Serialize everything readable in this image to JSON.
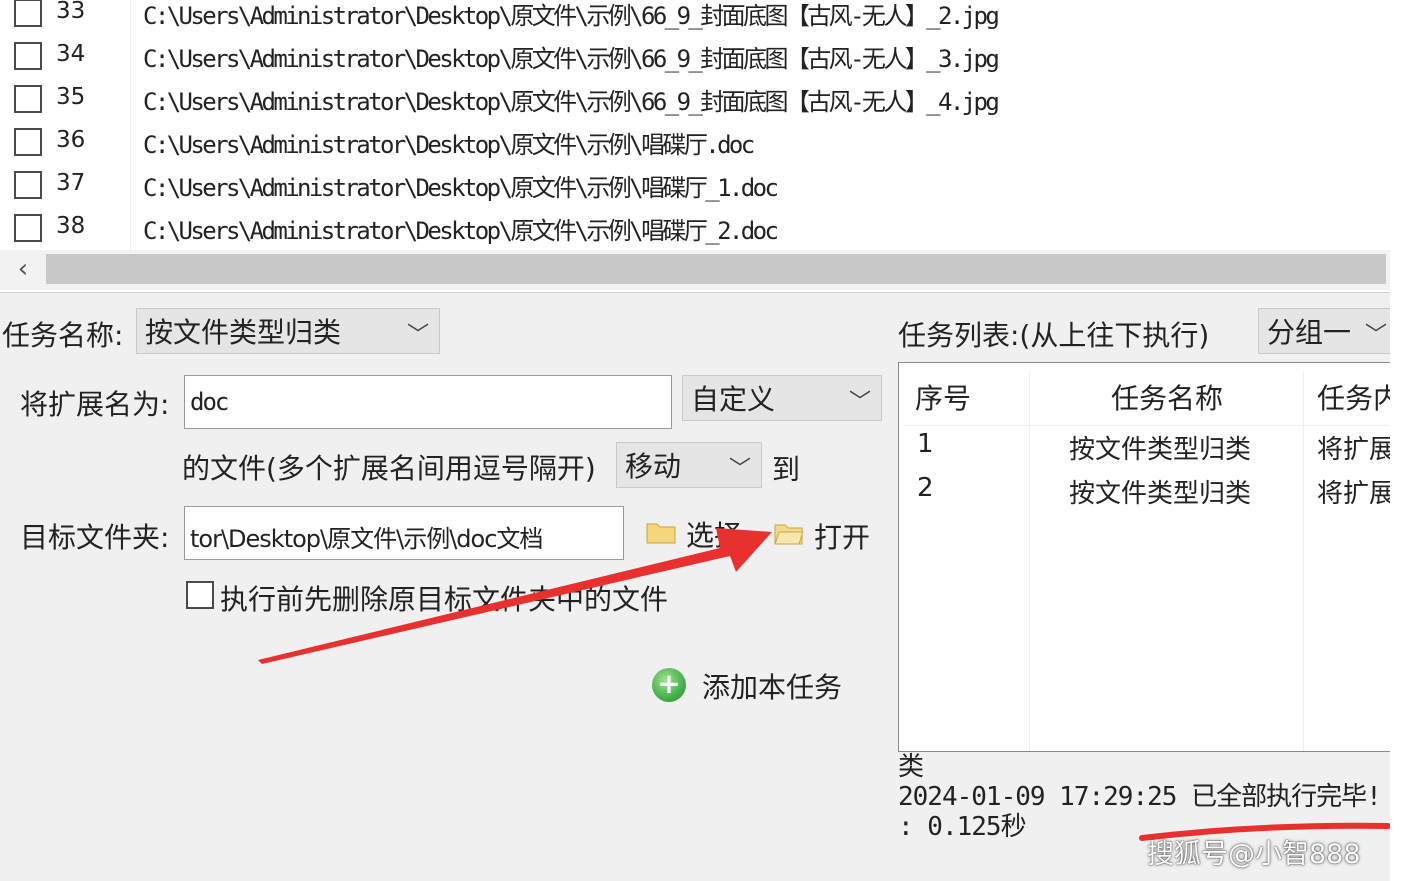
{
  "file_list": {
    "rows": [
      {
        "num": "33",
        "path": "C:\\Users\\Administrator\\Desktop\\原文件\\示例\\66_9_封面底图【古风-无人】_2.jpg"
      },
      {
        "num": "34",
        "path": "C:\\Users\\Administrator\\Desktop\\原文件\\示例\\66_9_封面底图【古风-无人】_3.jpg"
      },
      {
        "num": "35",
        "path": "C:\\Users\\Administrator\\Desktop\\原文件\\示例\\66_9_封面底图【古风-无人】_4.jpg"
      },
      {
        "num": "36",
        "path": "C:\\Users\\Administrator\\Desktop\\原文件\\示例\\唱碟厅.doc"
      },
      {
        "num": "37",
        "path": "C:\\Users\\Administrator\\Desktop\\原文件\\示例\\唱碟厅_1.doc"
      },
      {
        "num": "38",
        "path": "C:\\Users\\Administrator\\Desktop\\原文件\\示例\\唱碟厅_2.doc"
      }
    ],
    "scroll_left_glyph": "‹"
  },
  "form": {
    "task_name_label": "任务名称:",
    "task_name_value": "按文件类型归类",
    "ext_label": "将扩展名为:",
    "ext_value": "doc",
    "ext_mode_value": "自定义",
    "files_hint": "的文件(多个扩展名间用逗号隔开)",
    "action_value": "移动",
    "to_label": "到",
    "target_label": "目标文件夹:",
    "target_value": "tor\\Desktop\\原文件\\示例\\doc文档",
    "choose_label": "选择",
    "open_label": "打开",
    "delete_first_label": "执行前先删除原目标文件夹中的文件",
    "add_task_label": "添加本任务"
  },
  "task_list": {
    "label": "任务列表:(从上往下执行)",
    "group_value": "分组一",
    "columns": [
      "序号",
      "任务名称",
      "任务内"
    ],
    "rows": [
      {
        "index": "1",
        "name": "按文件类型归类",
        "content": "将扩展"
      },
      {
        "index": "2",
        "name": "按文件类型归类",
        "content": "将扩展"
      }
    ]
  },
  "log": {
    "line1": "类",
    "line2": "2024-01-09 17:29:25 已全部执行完毕!",
    "line3": ": 0.125秒"
  },
  "watermark": "搜狐号@小智888",
  "colors": {
    "arrow": "#e8312f",
    "panel_bg": "#f0f0f0",
    "add_icon": "#3aa640"
  }
}
